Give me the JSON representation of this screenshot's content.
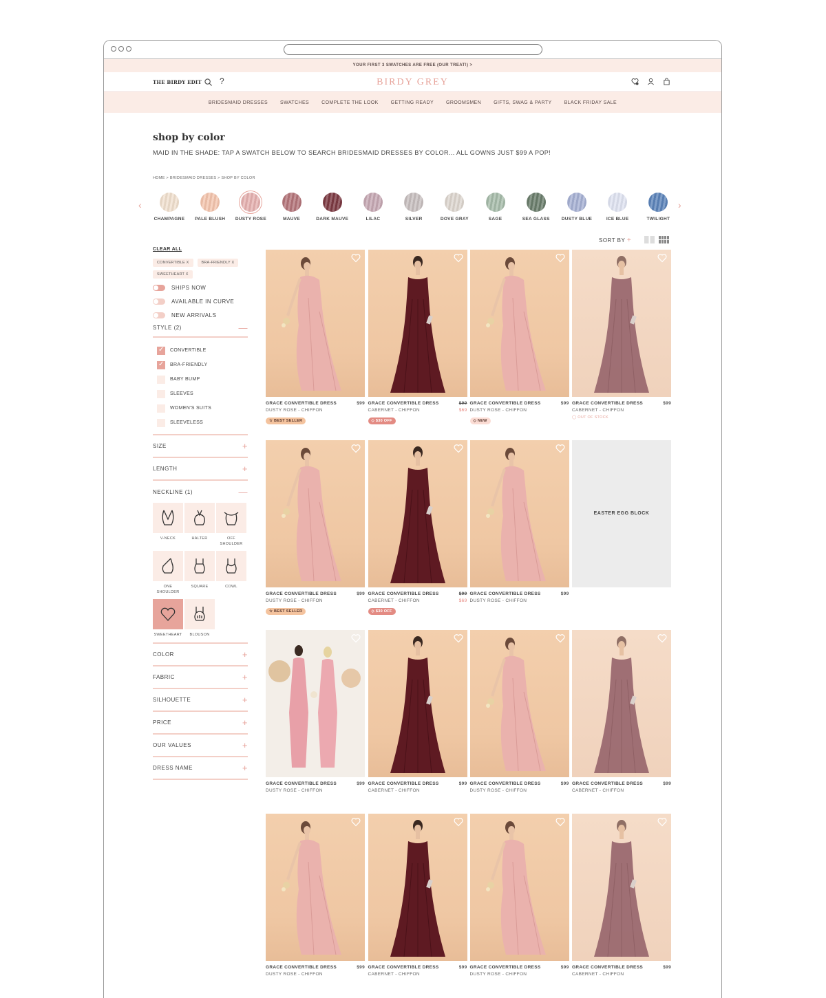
{
  "promo": "YOUR FIRST 3 SWATCHES ARE FREE (OUR TREAT!) >",
  "header": {
    "edit_logo": "THE BIRDY EDIT",
    "brand": "BIRDY GREY"
  },
  "nav": [
    "BRIDESMAID DRESSES",
    "SWATCHES",
    "COMPLETE THE LOOK",
    "GETTING READY",
    "GROOMSMEN",
    "GIFTS, SWAG & PARTY",
    "BLACK FRIDAY SALE"
  ],
  "page": {
    "title": "shop by color",
    "subtitle": "MAID IN THE SHADE: TAP A SWATCH BELOW TO SEARCH BRIDESMAID DRESSES BY COLOR... ALL GOWNS JUST $99 A POP!",
    "breadcrumb": "HOME > BRIDESMAID DRESSES > SHOP BY COLOR"
  },
  "swatches": [
    {
      "label": "CHAMPAGNE",
      "color": "#f1e0cf"
    },
    {
      "label": "PALE BLUSH",
      "color": "#f4c5ae"
    },
    {
      "label": "DUSTY ROSE",
      "color": "#e6b1b0"
    },
    {
      "label": "MAUVE",
      "color": "#b4757a"
    },
    {
      "label": "DARK MAUVE",
      "color": "#7c3a42"
    },
    {
      "label": "LILAC",
      "color": "#c6a8b3"
    },
    {
      "label": "SILVER",
      "color": "#c7bfbf"
    },
    {
      "label": "DOVE GRAY",
      "color": "#ddd6cf"
    },
    {
      "label": "SAGE",
      "color": "#a6bcaa"
    },
    {
      "label": "SEA GLASS",
      "color": "#6a7d6c"
    },
    {
      "label": "DUSTY BLUE",
      "color": "#a7b1d4"
    },
    {
      "label": "ICE BLUE",
      "color": "#dfe3f1"
    },
    {
      "label": "TWILIGHT",
      "color": "#5c84ba"
    }
  ],
  "sort_label": "SORT BY",
  "sidebar": {
    "clear_all": "CLEAR ALL",
    "chips": [
      "CONVERTIBLE X",
      "BRA-FRIENDLY X",
      "SWEETHEART X"
    ],
    "toggles": [
      "SHIPS NOW",
      "AVAILABLE IN CURVE",
      "NEW ARRIVALS"
    ],
    "style_header": "STYLE (2)",
    "styles": [
      {
        "label": "CONVERTIBLE",
        "checked": true
      },
      {
        "label": "BRA-FRIENDLY",
        "checked": true
      },
      {
        "label": "BABY BUMP",
        "checked": false
      },
      {
        "label": "SLEEVES",
        "checked": false
      },
      {
        "label": "WOMEN'S SUITS",
        "checked": false
      },
      {
        "label": "SLEEVELESS",
        "checked": false
      }
    ],
    "size": "SIZE",
    "length": "LENGTH",
    "neckline_header": "NECKLINE (1)",
    "necklines": [
      "V-NECK",
      "HALTER",
      "OFF SHOULDER",
      "ONE SHOULDER",
      "SQUARE",
      "COWL",
      "SWEETHEART",
      "BLOUSON"
    ],
    "more_filters": [
      "COLOR",
      "FABRIC",
      "SILHOUETTE",
      "PRICE",
      "OUR VALUES",
      "DRESS NAME"
    ]
  },
  "products": {
    "name": "GRACE CONVERTIBLE DRESS",
    "price": "$99",
    "old_price": "$99",
    "sale_price": "$69",
    "rose_variant": "DUSTY ROSE - CHIFFON",
    "cabernet_variant": "CABERNET - CHIFFON",
    "badges": {
      "best": "☆ BEST SELLER",
      "off": "◇ $30 OFF",
      "new": "◇ NEW",
      "oos": "◯ OUT OF STOCK"
    },
    "easter_egg": "EASTER EGG BLOCK"
  }
}
